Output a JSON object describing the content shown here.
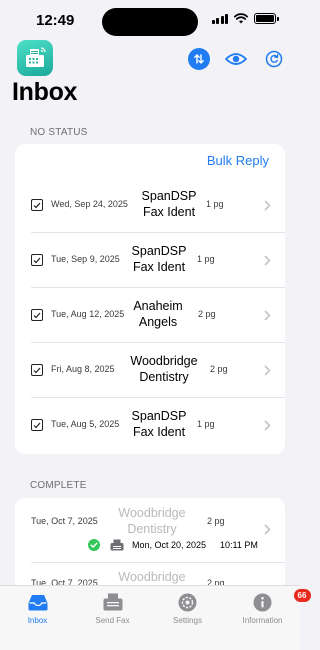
{
  "status_bar": {
    "time": "12:49"
  },
  "header": {
    "title": "Inbox"
  },
  "sections": {
    "no_status": {
      "title": "NO STATUS",
      "bulk_reply": "Bulk Reply",
      "rows": [
        {
          "date": "Wed, Sep 24, 2025",
          "sender_line1": "SpanDSP",
          "sender_line2": "Fax Ident",
          "pages": "1 pg",
          "checked": true
        },
        {
          "date": "Tue, Sep 9, 2025",
          "sender_line1": "SpanDSP",
          "sender_line2": "Fax Ident",
          "pages": "1 pg",
          "checked": true
        },
        {
          "date": "Tue, Aug 12, 2025",
          "sender_line1": "Anaheim",
          "sender_line2": "Angels",
          "pages": "2 pg",
          "checked": true
        },
        {
          "date": "Fri, Aug 8, 2025",
          "sender_line1": "Woodbridge",
          "sender_line2": "Dentistry",
          "pages": "2 pg",
          "checked": true
        },
        {
          "date": "Tue, Aug 5, 2025",
          "sender_line1": "SpanDSP",
          "sender_line2": "Fax Ident",
          "pages": "1 pg",
          "checked": true
        }
      ]
    },
    "complete": {
      "title": "COMPLETE",
      "rows": [
        {
          "date": "Tue, Oct 7, 2025",
          "sender_line1": "Woodbridge",
          "sender_line2": "Dentistry",
          "pages": "2 pg",
          "sent_date": "Mon, Oct 20, 2025",
          "sent_time": "10:11 PM"
        },
        {
          "date": "Tue, Oct 7, 2025",
          "sender_line1": "Woodbridge",
          "sender_line2": "",
          "pages": "2 pg"
        }
      ]
    }
  },
  "tabs": [
    {
      "label": "Inbox",
      "icon": "inbox-tray-icon",
      "active": true
    },
    {
      "label": "Send Fax",
      "icon": "fax-machine-icon",
      "active": false
    },
    {
      "label": "Settings",
      "icon": "gear-icon",
      "active": false
    },
    {
      "label": "Information",
      "icon": "info-icon",
      "active": false,
      "badge": "66"
    }
  ],
  "colors": {
    "accent": "#1f7cf2",
    "badge": "#e8291c",
    "success": "#34c759",
    "app_icon": "#2bc3ad"
  }
}
